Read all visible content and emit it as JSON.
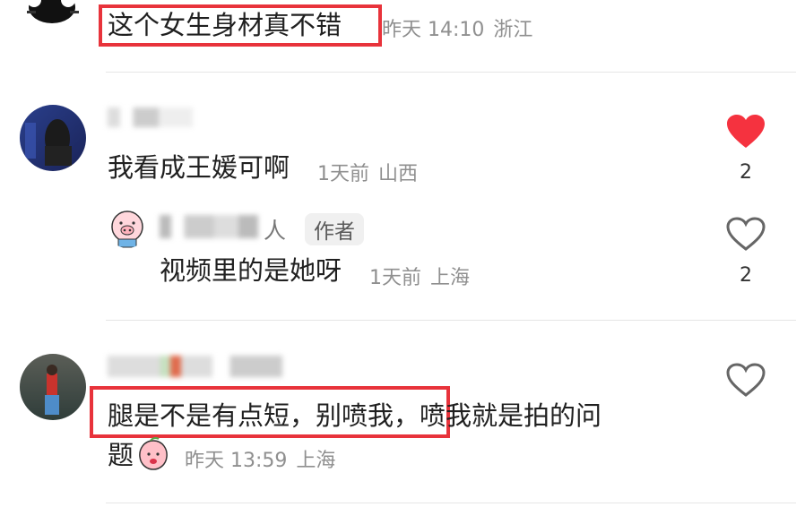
{
  "comments": [
    {
      "text": "这个女生身材真不错",
      "date": "昨天 14:10",
      "location": "浙江"
    },
    {
      "text": "我看成王媛可啊",
      "date": "1天前",
      "location": "山西",
      "likes": "2",
      "liked": true,
      "reply": {
        "username": "人",
        "badge": "作者",
        "text": "视频里的是她呀",
        "date": "1天前",
        "location": "上海",
        "likes": "2"
      }
    },
    {
      "text_highlight": "腿是不是有点短，别喷我，",
      "text_rest": "喷我就是拍的问",
      "text_line2": "题",
      "date": "昨天 13:59",
      "location": "上海"
    }
  ],
  "colors": {
    "accent": "#f5323f",
    "highlight_box": "#e8333b"
  },
  "icons": [
    "heart-icon",
    "heart-outline-icon",
    "pig-face-emoji",
    "peach-emoji"
  ]
}
